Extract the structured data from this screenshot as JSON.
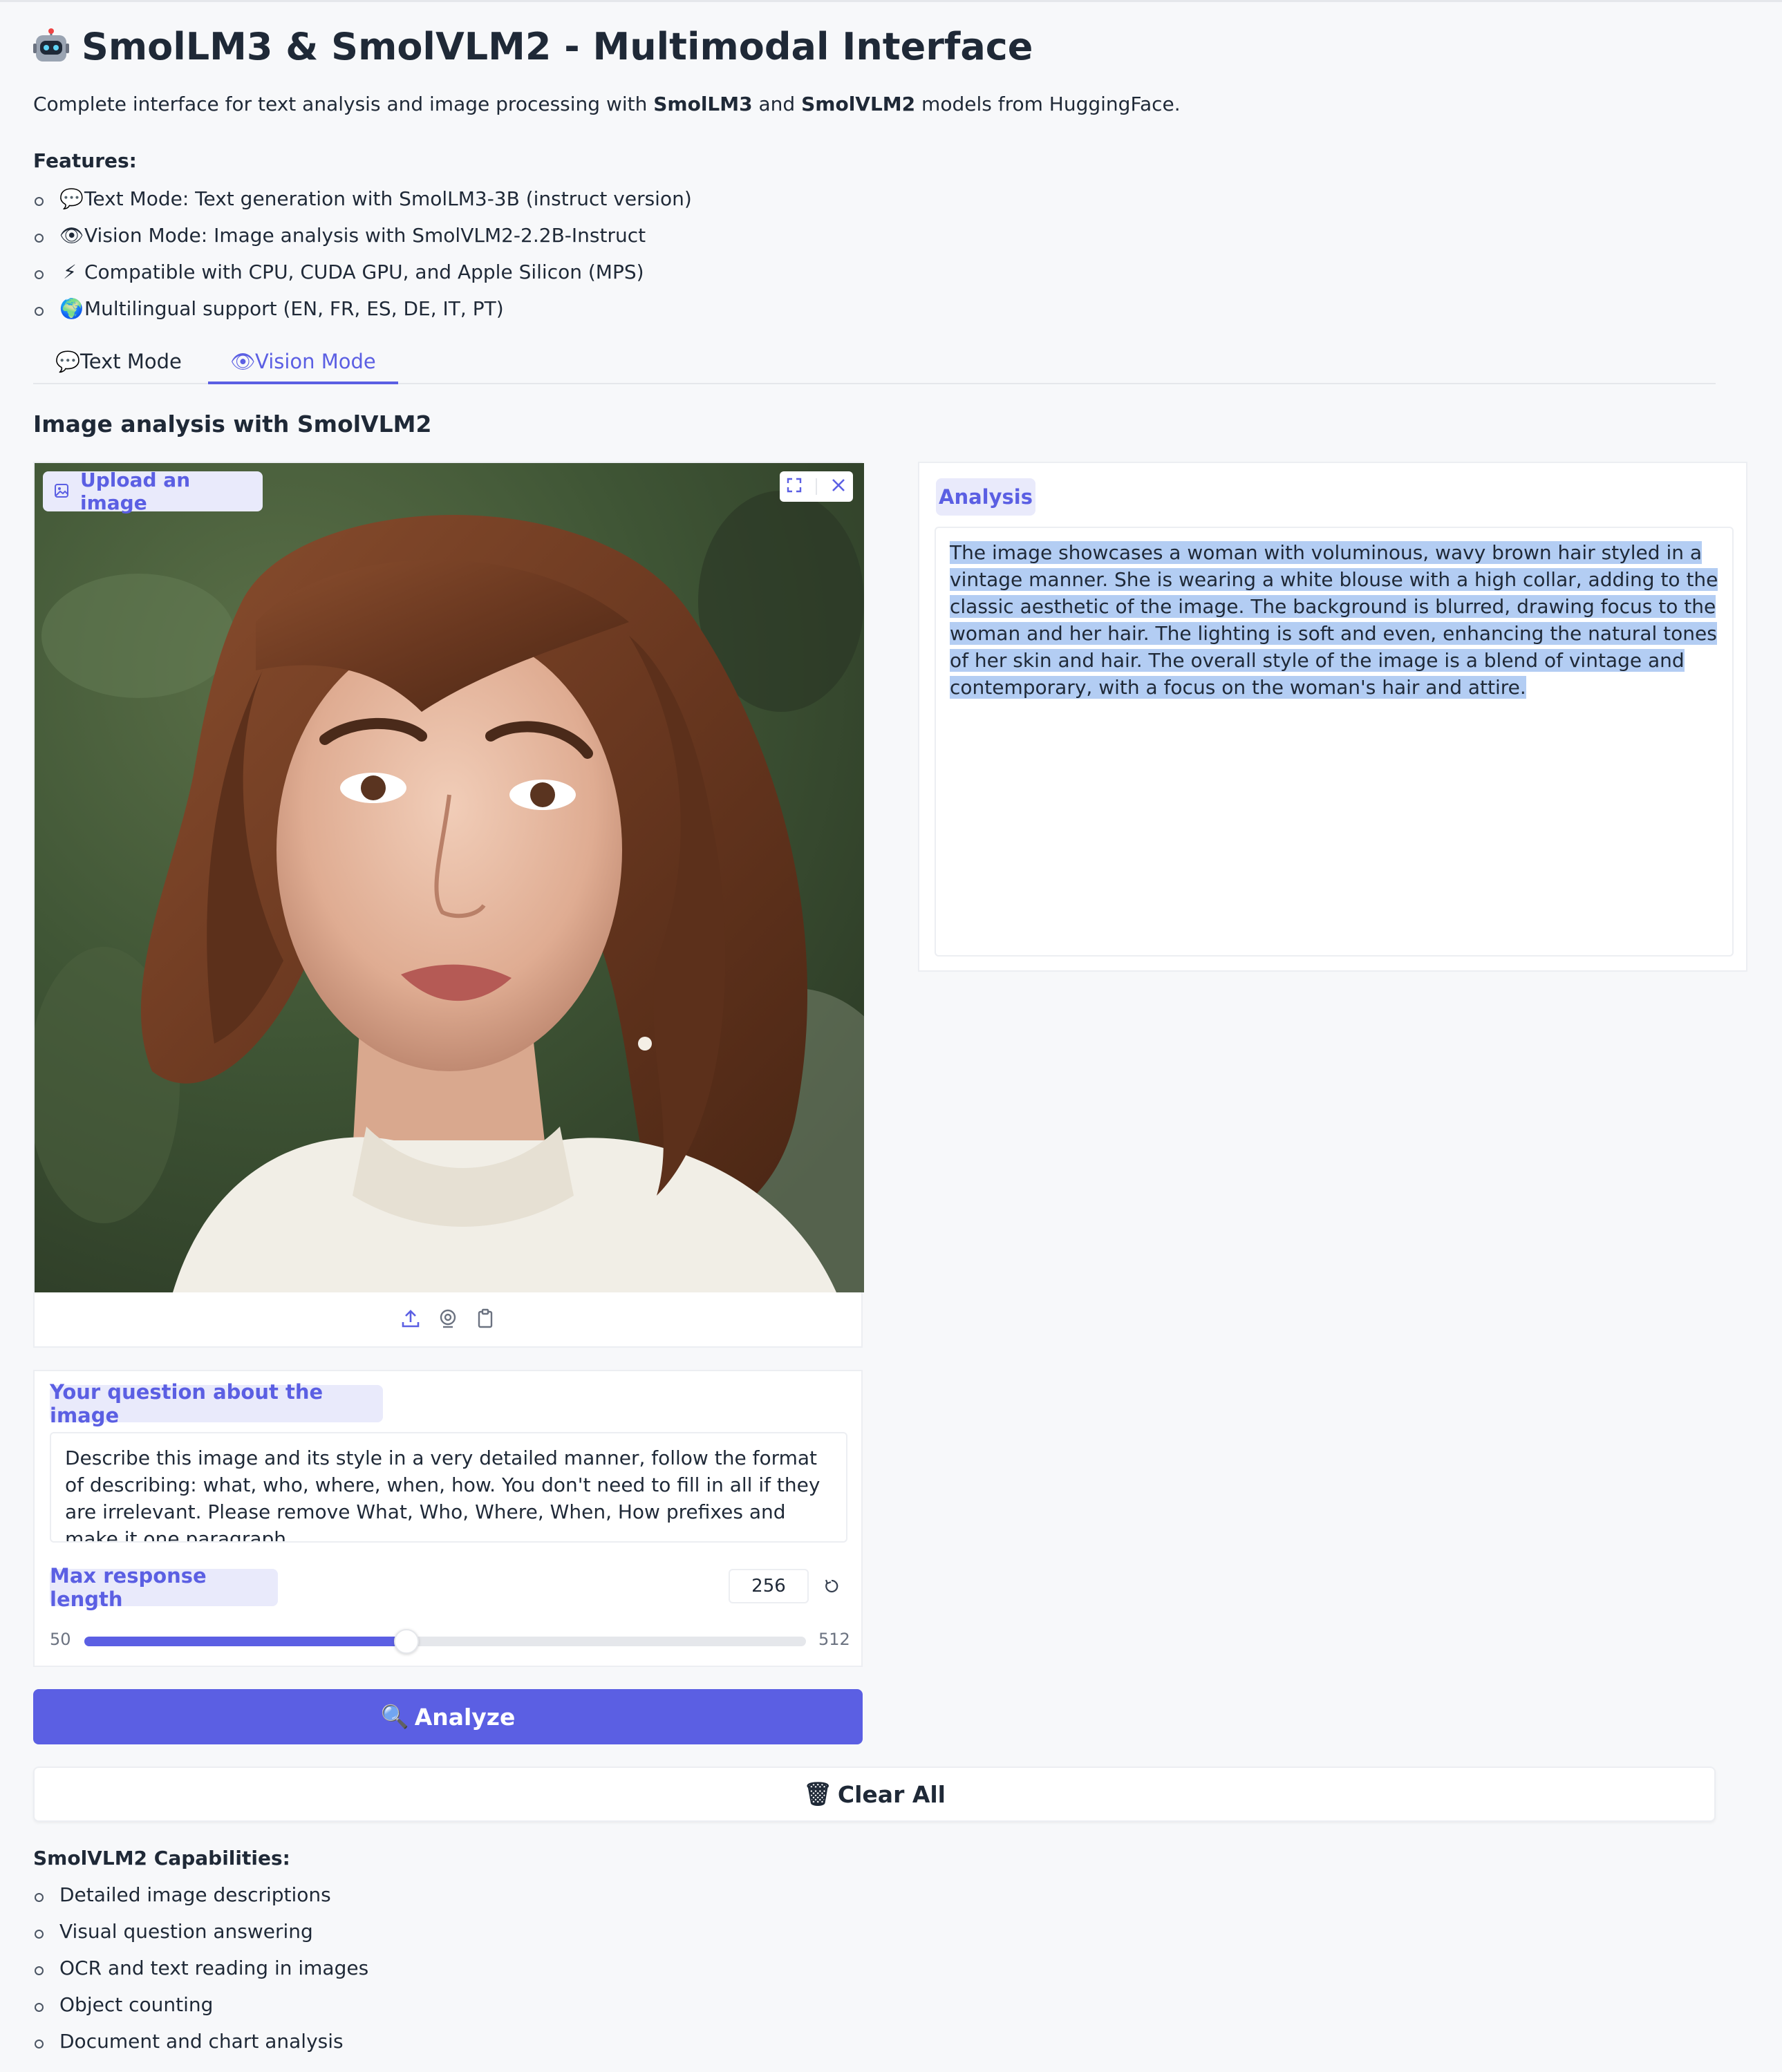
{
  "header": {
    "title": "SmolLM3 & SmolVLM2 - Multimodal Interface",
    "intro_prefix": "Complete interface for text analysis and image processing with ",
    "intro_model1": "SmolLM3",
    "intro_and": " and ",
    "intro_model2": "SmolVLM2",
    "intro_suffix": " models from HuggingFace."
  },
  "features": {
    "heading": "Features:",
    "items": [
      {
        "icon": "speech-bubble-icon",
        "glyph": "💬",
        "text": "Text Mode: Text generation with SmolLM3-3B (instruct version)"
      },
      {
        "icon": "eye-icon",
        "glyph": "👁",
        "text": "Vision Mode: Image analysis with SmolVLM2-2.2B-Instruct"
      },
      {
        "icon": "lightning-icon",
        "glyph": "⚡",
        "text": "Compatible with CPU, CUDA GPU, and Apple Silicon (MPS)"
      },
      {
        "icon": "globe-icon",
        "glyph": "🌍",
        "text": "Multilingual support (EN, FR, ES, DE, IT, PT)"
      }
    ]
  },
  "tabs": [
    {
      "glyph": "💬",
      "label": "Text Mode",
      "active": false
    },
    {
      "glyph": "👁",
      "label": "Vision Mode",
      "active": true
    }
  ],
  "section_title": "Image analysis with SmolVLM2",
  "image_input": {
    "label": "Upload an image"
  },
  "analysis": {
    "label": "Analysis",
    "text": "The image showcases a woman with voluminous, wavy brown hair styled in a vintage manner. She is wearing a white blouse with a high collar, adding to the classic aesthetic of the image. The background is blurred, drawing focus to the woman and her hair. The lighting is soft and even, enhancing the natural tones of her skin and hair. The overall style of the image is a blend of vintage and contemporary, with a focus on the woman's hair and attire."
  },
  "question": {
    "label": "Your question about the image",
    "value": "Describe this image and its style in a very detailed manner, follow the format of describing: what, who, where, when, how. You don't need to fill in all if they are irrelevant. Please remove What, Who, Where, When, How prefixes and make it one paragraph."
  },
  "max_length": {
    "label": "Max response length",
    "value": "256",
    "min": "50",
    "max": "512",
    "level": 256
  },
  "buttons": {
    "analyze_glyph": "🔍",
    "analyze": "Analyze",
    "clear_glyph": "🗑",
    "clear": "Clear All"
  },
  "capabilities": {
    "heading": "SmolVLM2 Capabilities:",
    "items": [
      "Detailed image descriptions",
      "Visual question answering",
      "OCR and text reading in images",
      "Object counting",
      "Document and chart analysis"
    ]
  },
  "colors": {
    "accent": "#5b5fe3",
    "label_bg": "#e9eafb",
    "selection": "#b3cdf3"
  }
}
